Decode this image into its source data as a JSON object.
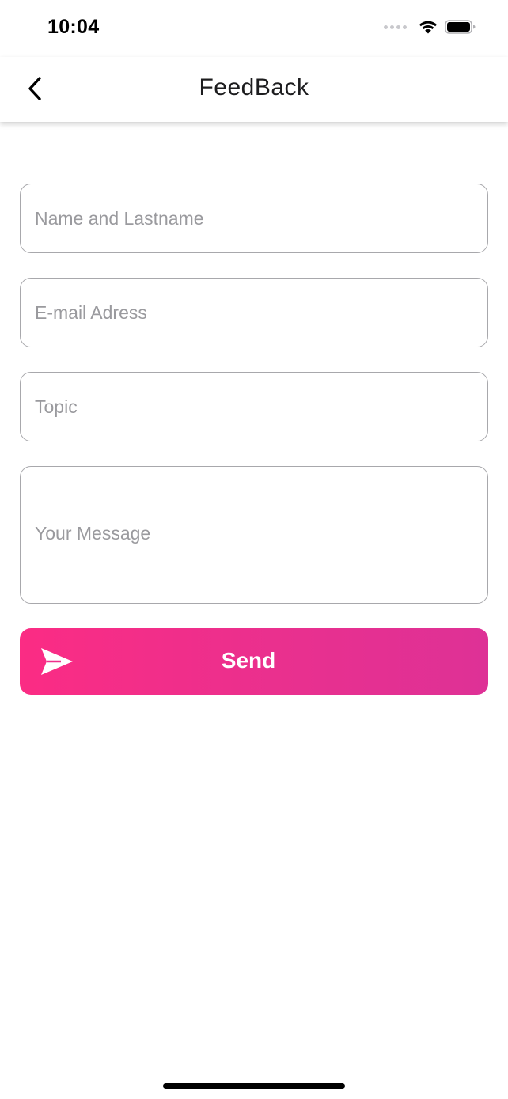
{
  "status_bar": {
    "time": "10:04"
  },
  "nav": {
    "title": "FeedBack",
    "back_icon": "chevron-left-icon"
  },
  "form": {
    "name_placeholder": "Name and Lastname",
    "name_value": "",
    "email_placeholder": "E-mail Adress",
    "email_value": "",
    "topic_placeholder": "Topic",
    "topic_value": "",
    "message_placeholder": "Your Message",
    "message_value": ""
  },
  "send_button": {
    "label": "Send",
    "icon": "send-icon"
  },
  "colors": {
    "accent_start": "#fb2c84",
    "accent_end": "#de3196",
    "field_border": "#a8a8ac",
    "placeholder": "#9a9a9e"
  }
}
